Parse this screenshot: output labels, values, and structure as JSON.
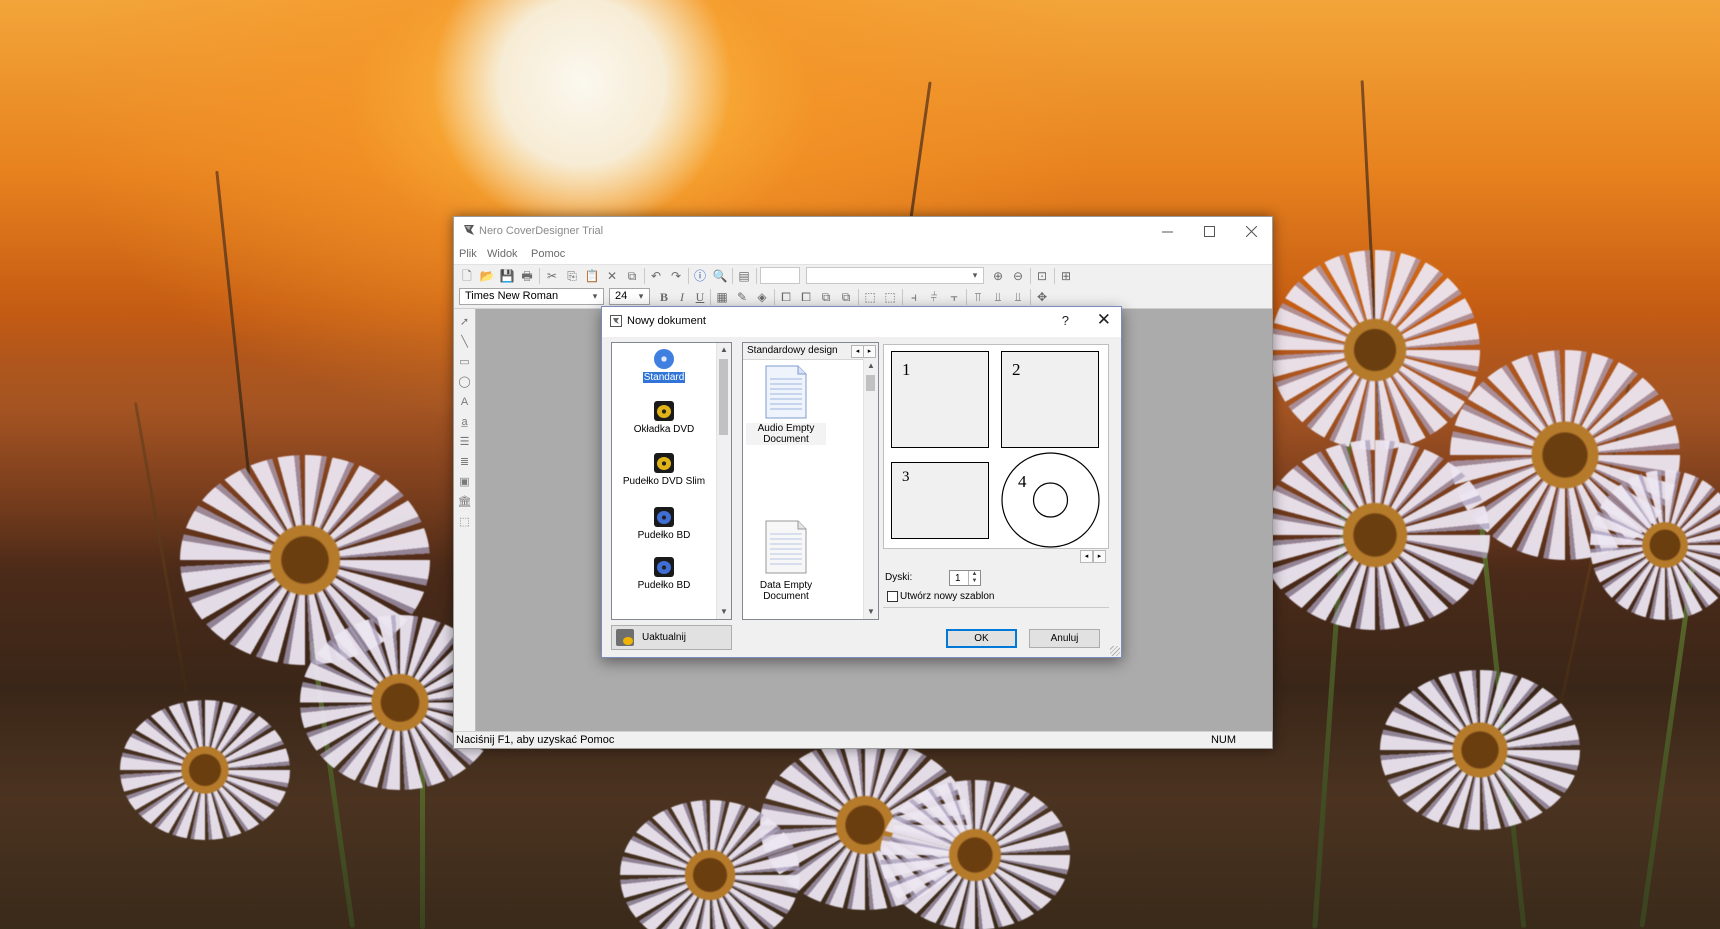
{
  "window": {
    "title": "Nero CoverDesigner Trial",
    "menu": [
      "Plik",
      "Widok",
      "Pomoc"
    ],
    "font_family_value": "Times New Roman",
    "font_size_value": "24",
    "status_text": "Naciśnij F1, aby uzyskać Pomoc",
    "status_num": "NUM"
  },
  "dialog": {
    "title": "Nowy dokument",
    "help_glyph": "?",
    "close_glyph": "✕",
    "categories": [
      {
        "label": "Standard",
        "selected": true
      },
      {
        "label": "Okładka DVD",
        "selected": false
      },
      {
        "label": "Pudełko DVD Slim",
        "selected": false
      },
      {
        "label": "Pudełko BD",
        "selected": false
      },
      {
        "label": "Pudełko BD",
        "selected": false
      }
    ],
    "template_header": "Standardowy design",
    "templates": [
      "Audio Empty Document",
      "Data Empty Document"
    ],
    "preview_parts": [
      "1",
      "2",
      "3",
      "4"
    ],
    "disks_label": "Dyski:",
    "disks_value": "1",
    "new_template_label": "Utwórz nowy szablon",
    "update_label": "Uaktualnij",
    "ok_label": "OK",
    "cancel_label": "Anuluj"
  },
  "colors": {
    "selection": "#3074d8",
    "default_button_border": "#0078d7",
    "canvas": "#ababab"
  }
}
